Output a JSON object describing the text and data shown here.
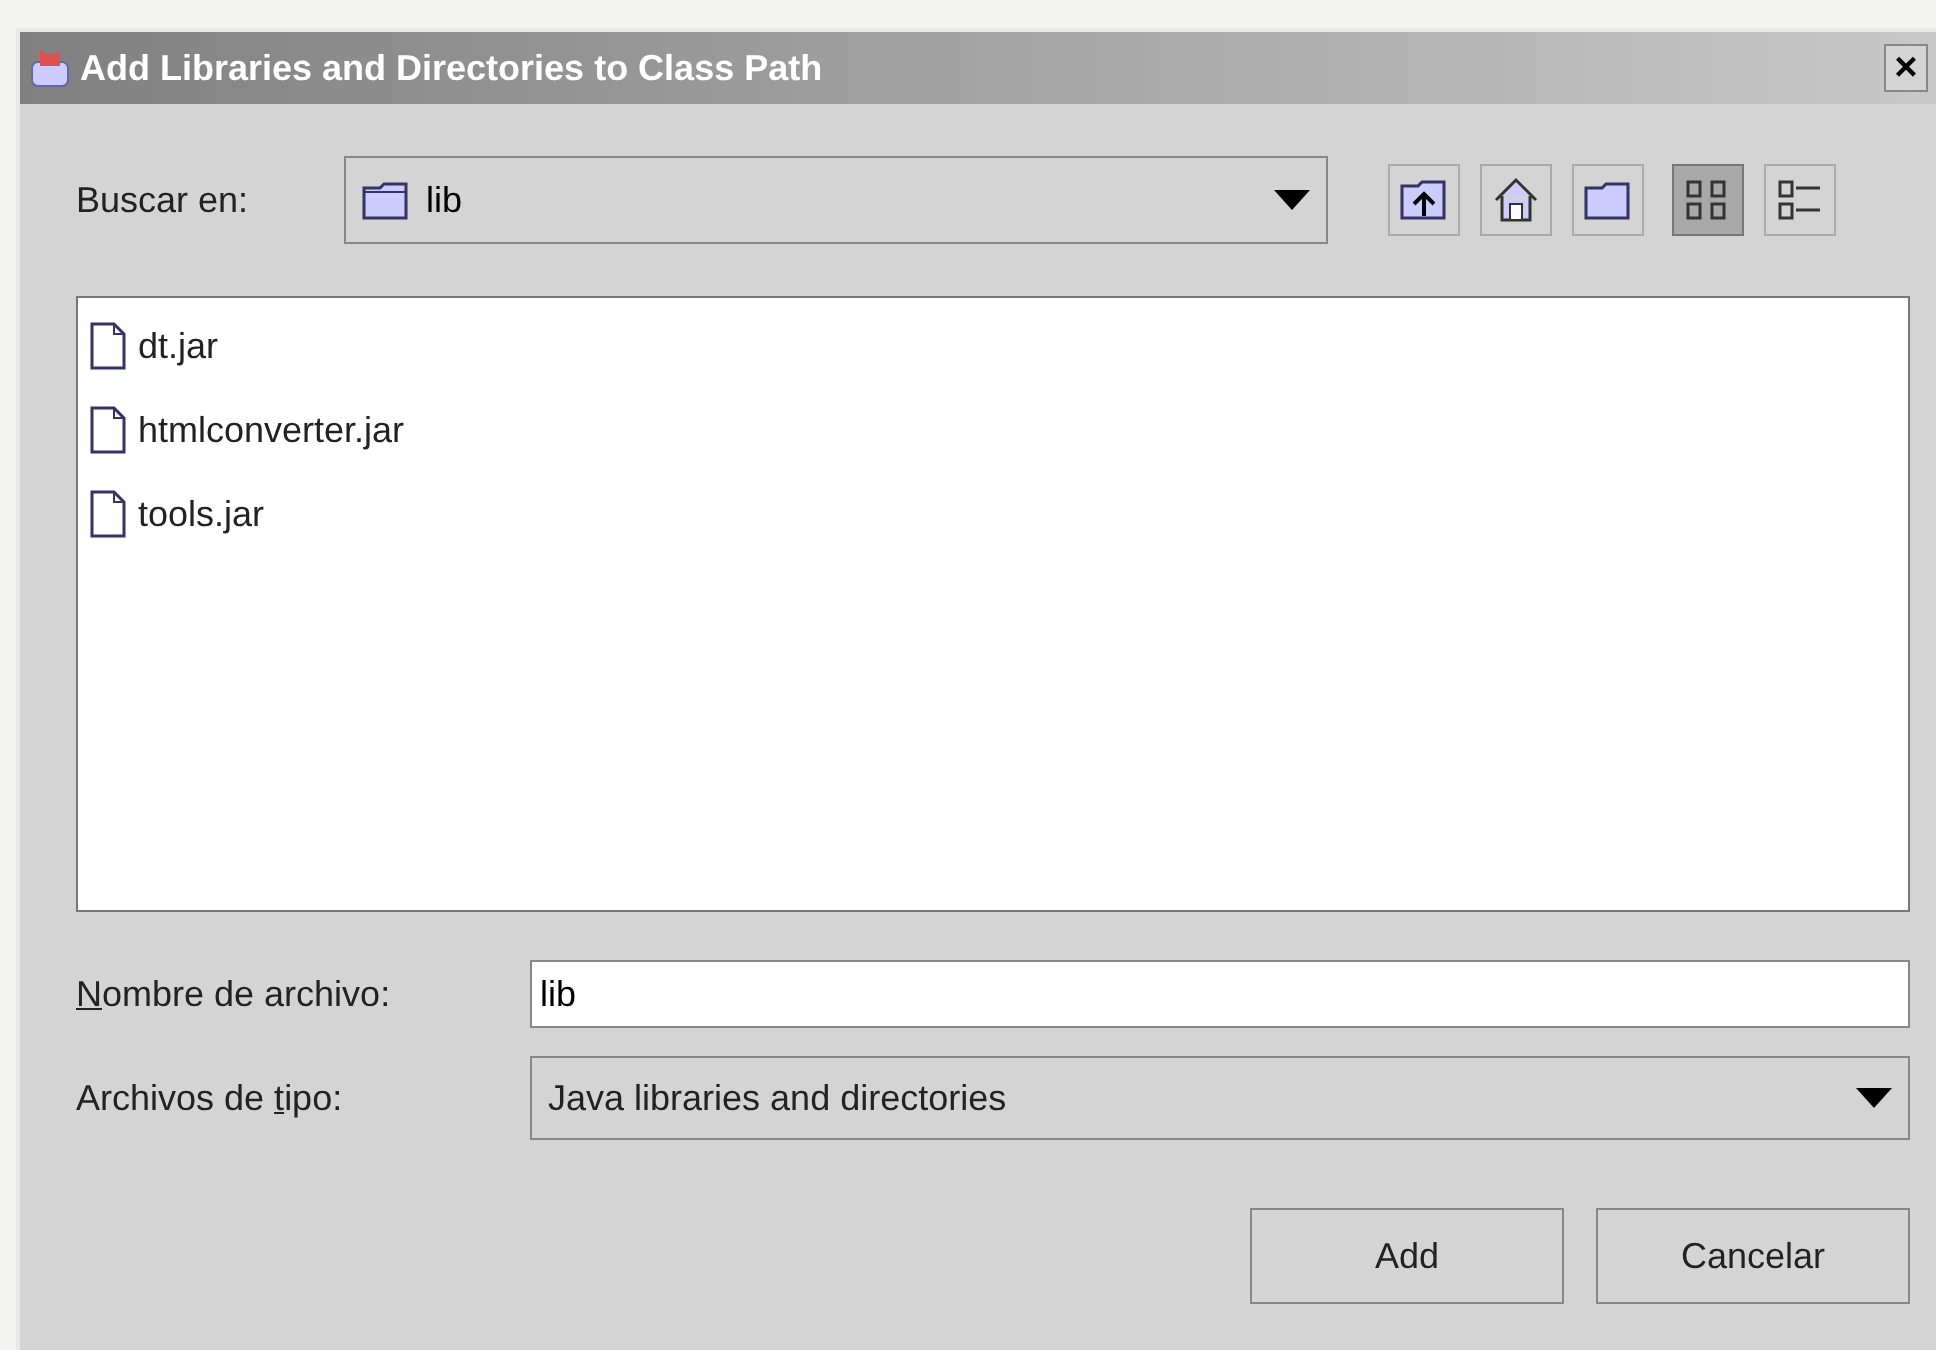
{
  "window": {
    "title": "Add Libraries and Directories to Class Path",
    "close": "×"
  },
  "look_in": {
    "label": "Buscar en:",
    "value": "lib"
  },
  "toolbar": [
    {
      "kind": "up",
      "selected": false
    },
    {
      "kind": "home",
      "selected": false
    },
    {
      "kind": "new-folder",
      "selected": false
    },
    {
      "kind": "list",
      "selected": true
    },
    {
      "kind": "details",
      "selected": false
    }
  ],
  "files": [
    {
      "name": "dt.jar"
    },
    {
      "name": "htmlconverter.jar"
    },
    {
      "name": "tools.jar"
    }
  ],
  "file_name": {
    "label": {
      "mnemonic": "N",
      "after": "ombre de archivo:"
    },
    "value": "lib"
  },
  "file_type": {
    "label": {
      "before": "Archivos de ",
      "mnemonic": "t",
      "after": "ipo:"
    },
    "value": "Java libraries and directories"
  },
  "buttons": [
    "Add",
    "Cancelar"
  ]
}
